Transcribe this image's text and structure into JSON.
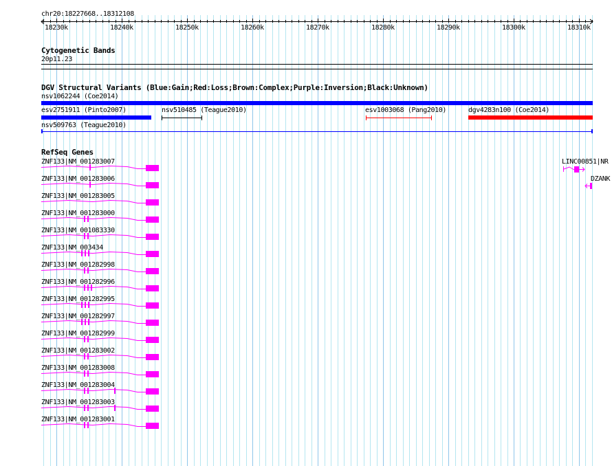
{
  "ruler": {
    "location": "chr20:18227668..18312108",
    "start": 18227668,
    "end": 18312108,
    "ticks": [
      "18230k",
      "18240k",
      "18250k",
      "18260k",
      "18270k",
      "18280k",
      "18290k",
      "18300k",
      "18310k"
    ]
  },
  "cytoband": {
    "title": "Cytogenetic Bands",
    "band": "20p11.23"
  },
  "dgv": {
    "title": "DGV Structural Variants (Blue:Gain;Red:Loss;Brown:Complex;Purple:Inversion;Black:Unknown)",
    "variants": [
      {
        "label": "nsv1062244 (Coe2014)",
        "color": "#0000ff"
      },
      {
        "label": "esv2751911 (Pinto2007)",
        "color": "#0000ff"
      },
      {
        "label": "nsv510485 (Teague2010)",
        "color": "#000000"
      },
      {
        "label": "esv1003068 (Pang2010)",
        "color": "#ff0000"
      },
      {
        "label": "dgv4283n100 (Coe2014)",
        "color": "#ff0000"
      },
      {
        "label": "nsv509763 (Teague2010)",
        "color": "#0000ff"
      }
    ]
  },
  "refseq": {
    "title": "RefSeq Genes",
    "color": "#ff00ff",
    "genes": [
      "ZNF133|NM_001283007",
      "ZNF133|NM_001283006",
      "ZNF133|NM_001283005",
      "ZNF133|NM_001283000",
      "ZNF133|NM_001083330",
      "ZNF133|NM_003434",
      "ZNF133|NM_001282998",
      "ZNF133|NM_001282996",
      "ZNF133|NM_001282995",
      "ZNF133|NM_001282997",
      "ZNF133|NM_001282999",
      "ZNF133|NM_001283002",
      "ZNF133|NM_001283008",
      "ZNF133|NM_001283004",
      "ZNF133|NM_001283003",
      "ZNF133|NM_001283001"
    ],
    "other_genes": [
      "LINC00851|NR",
      "DZANK"
    ]
  }
}
